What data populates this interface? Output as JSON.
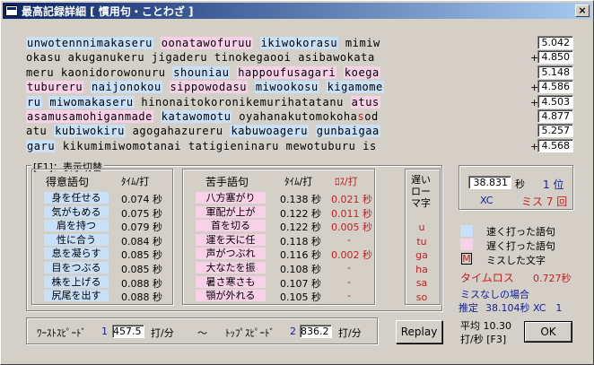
{
  "window": {
    "title": "最高記録詳細 [ 慣用句・ことわざ ]",
    "close_label": "×"
  },
  "lines": [
    {
      "segments": [
        {
          "t": "unwotennnimakaseru",
          "c": "f"
        },
        {
          "t": " ",
          "c": "n"
        },
        {
          "t": "oonatawofuruu",
          "c": "s"
        },
        {
          "t": " ",
          "c": "n"
        },
        {
          "t": "ikiwokorasu",
          "c": "f"
        },
        {
          "t": " mimiw",
          "c": "n"
        }
      ],
      "time": "5.042",
      "plus": ""
    },
    {
      "segments": [
        {
          "t": "okasu akuganukeru jigaderu tinokegaooi asibawokata",
          "c": "n"
        }
      ],
      "time": "4.850",
      "plus": "+"
    },
    {
      "segments": [
        {
          "t": "meru kaonidorowonuru ",
          "c": "n"
        },
        {
          "t": "shouniau",
          "c": "f"
        },
        {
          "t": " ",
          "c": "n"
        },
        {
          "t": "happoufusagari",
          "c": "s"
        },
        {
          "t": " ",
          "c": "n"
        },
        {
          "t": "koega",
          "c": "s"
        }
      ],
      "time": "5.148",
      "plus": ""
    },
    {
      "segments": [
        {
          "t": "tubureru",
          "c": "s"
        },
        {
          "t": " ",
          "c": "n"
        },
        {
          "t": "naijonokou",
          "c": "f"
        },
        {
          "t": " ",
          "c": "n"
        },
        {
          "t": "sippowodasu",
          "c": "s"
        },
        {
          "t": " ",
          "c": "n"
        },
        {
          "t": "miwookosu",
          "c": "f"
        },
        {
          "t": " ",
          "c": "n"
        },
        {
          "t": "kigamome",
          "c": "f"
        }
      ],
      "time": "4.586",
      "plus": "+"
    },
    {
      "segments": [
        {
          "t": "ru",
          "c": "f"
        },
        {
          "t": " ",
          "c": "n"
        },
        {
          "t": "miwomakaseru",
          "c": "f"
        },
        {
          "t": " hinonaitokoronikemurihatatanu ",
          "c": "n"
        },
        {
          "t": "atus",
          "c": "s"
        }
      ],
      "time": "4.503",
      "plus": "+"
    },
    {
      "segments": [
        {
          "t": "asamusamohiganmade",
          "c": "s"
        },
        {
          "t": " ",
          "c": "n"
        },
        {
          "t": "katawomotu",
          "c": "f"
        },
        {
          "t": " oyahanakutomokoha",
          "c": "n"
        },
        {
          "t": "s",
          "c": "miss"
        },
        {
          "t": "od",
          "c": "n"
        }
      ],
      "time": "4.877",
      "plus": ""
    },
    {
      "segments": [
        {
          "t": "atu",
          "c": "n"
        },
        {
          "t": " ",
          "c": "n"
        },
        {
          "t": "kubiwokiru",
          "c": "f"
        },
        {
          "t": " agogahazureru ",
          "c": "n"
        },
        {
          "t": "kabuwoageru",
          "c": "f"
        },
        {
          "t": " ",
          "c": "n"
        },
        {
          "t": "gunbaigaa",
          "c": "f"
        }
      ],
      "time": "5.257",
      "plus": ""
    },
    {
      "segments": [
        {
          "t": "garu",
          "c": "f"
        },
        {
          "t": " kikumimiwomotanai tatigieninaru mewotuburu is",
          "c": "n"
        }
      ],
      "time": "4.568",
      "plus": "+"
    }
  ],
  "panel": {
    "label": "[F1]：表示切替",
    "good_header": "得意語句",
    "time_header": "ﾀｲﾑ/打",
    "bad_header": "苦手語句",
    "time_header2": "ﾀｲﾑ/打",
    "loss_header": "ﾛｽ/打",
    "good": [
      {
        "w": "身を任せる",
        "t": "0.074 秒"
      },
      {
        "w": "気がもめる",
        "t": "0.075 秒"
      },
      {
        "w": "肩を持つ",
        "t": "0.079 秒"
      },
      {
        "w": "性に合う",
        "t": "0.084 秒"
      },
      {
        "w": "息を凝らす",
        "t": "0.085 秒"
      },
      {
        "w": "目をつぶる",
        "t": "0.085 秒"
      },
      {
        "w": "株を上げる",
        "t": "0.088 秒"
      },
      {
        "w": "尻尾を出す",
        "t": "0.088 秒"
      }
    ],
    "bad": [
      {
        "w": "八方塞がり",
        "t": "0.138 秒",
        "l": "0.021 秒"
      },
      {
        "w": "軍配が上が",
        "t": "0.122 秒",
        "l": "0.011 秒"
      },
      {
        "w": "首を切る",
        "t": "0.122 秒",
        "l": "0.005 秒"
      },
      {
        "w": "運を天に任",
        "t": "0.118 秒",
        "l": "-"
      },
      {
        "w": "声がつぶれ",
        "t": "0.116 秒",
        "l": "0.002 秒"
      },
      {
        "w": "大なたを振",
        "t": "0.108 秒",
        "l": "-"
      },
      {
        "w": "暑さ寒さも",
        "t": "0.107 秒",
        "l": "-"
      },
      {
        "w": "顎が外れる",
        "t": "0.105 秒",
        "l": "-"
      }
    ],
    "slow_header": [
      "遅い",
      "ロー",
      "マ字"
    ],
    "slow_chars": [
      "u",
      "tu",
      "ga",
      "ha",
      "sa",
      "so"
    ]
  },
  "stats": {
    "time": "38.831",
    "time_unit": "秒",
    "rank": "1 位",
    "xc": "XC",
    "miss": "ミス 7 回",
    "legend_fast": "速く打った語句",
    "legend_slow": "遅く打った語句",
    "legend_miss_mark": "M",
    "legend_miss": "ミスした文字",
    "timeloss_label": "タイムロス",
    "timeloss_value": "0.727秒",
    "nomiss_label": "ミスなしの場合",
    "estimate_label": "推定",
    "estimate_value": "38.104秒 XC　1"
  },
  "speed": {
    "worst_label": "ﾜｰｽﾄｽﾋﾟｰﾄﾞ",
    "worst_num": "1",
    "worst_value": "457.5",
    "unit": "打/分",
    "tilde": "〜",
    "top_label": "ﾄｯﾌﾟｽﾋﾟｰﾄﾞ",
    "top_num": "2",
    "top_value": "836.2",
    "unit2": "打/分"
  },
  "buttons": {
    "replay": "Replay",
    "ok": "OK"
  },
  "avg": {
    "line1": "平均 10.30",
    "line2": "打/秒 [F3]"
  }
}
